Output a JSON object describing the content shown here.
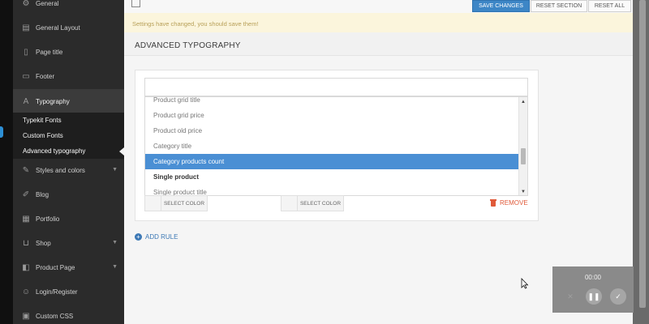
{
  "sidebar": {
    "items": [
      {
        "label": "General",
        "icon": "gear-icon"
      },
      {
        "label": "General Layout",
        "icon": "layout-icon"
      },
      {
        "label": "Page title",
        "icon": "document-icon"
      },
      {
        "label": "Footer",
        "icon": "monitor-icon"
      },
      {
        "label": "Typography",
        "icon": "font-icon"
      },
      {
        "label": "Styles and colors",
        "icon": "palette-icon"
      },
      {
        "label": "Blog",
        "icon": "pencil-icon"
      },
      {
        "label": "Portfolio",
        "icon": "grid-icon"
      },
      {
        "label": "Shop",
        "icon": "cart-icon"
      },
      {
        "label": "Product Page",
        "icon": "layers-icon"
      },
      {
        "label": "Login/Register",
        "icon": "user-icon"
      },
      {
        "label": "Custom CSS",
        "icon": "code-icon"
      }
    ],
    "subitems": [
      {
        "label": "Typekit Fonts"
      },
      {
        "label": "Custom Fonts"
      },
      {
        "label": "Advanced typography"
      }
    ]
  },
  "toolbar": {
    "save_label": "SAVE CHANGES",
    "reset_section_label": "RESET SECTION",
    "reset_all_label": "RESET ALL"
  },
  "notice": "Settings have changed, you should save them!",
  "section_title": "ADVANCED TYPOGRAPHY",
  "dropdown": {
    "search_value": "",
    "options": [
      {
        "label": "Product grid title"
      },
      {
        "label": "Product grid price"
      },
      {
        "label": "Product old price"
      },
      {
        "label": "Category title"
      },
      {
        "label": "Category products count"
      },
      {
        "label": "Single product"
      },
      {
        "label": "Single product title"
      }
    ],
    "selected": "Category products count"
  },
  "color_pickers": [
    {
      "label": "SELECT COLOR"
    },
    {
      "label": "SELECT COLOR"
    }
  ],
  "remove_label": "REMOVE",
  "add_rule_label": "ADD RULE",
  "recorder": {
    "time": "00:00"
  },
  "colors": {
    "accent": "#3d86c6",
    "selected": "#4a8fd4",
    "remove": "#e05a3a",
    "sidebar": "#2b2b2b",
    "notice_bg": "#fbf5dc"
  }
}
